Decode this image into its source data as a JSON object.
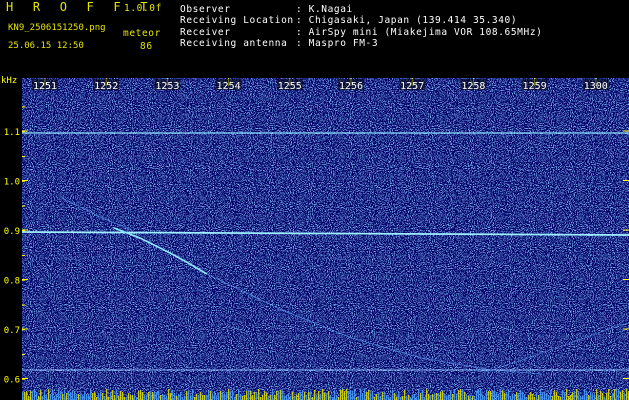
{
  "header": {
    "logo": "H R O F F T",
    "version": "1.0.0f",
    "filename": "KN9_2506151250.png",
    "datetime": "25.06.15 12:50",
    "meteor_label": "meteor",
    "meteor_count": "86",
    "fields": [
      {
        "label": "Observer",
        "value": ": K.Nagai"
      },
      {
        "label": "Receiving Location",
        "value": ": Chigasaki, Japan (139.414 35.340)"
      },
      {
        "label": "Receiver",
        "value": ": AirSpy mini (Miakejima VOR 108.65MHz)"
      },
      {
        "label": "Receiving antenna",
        "value": ": Maspro FM-3"
      }
    ]
  },
  "spectrogram": {
    "y_unit": "kHz",
    "y_ticks": [
      "1.1",
      "1.0",
      "0.9",
      "0.8",
      "0.7",
      "0.6"
    ],
    "x_ticks": [
      "1251",
      "1252",
      "1253",
      "1254",
      "1255",
      "1256",
      "1257",
      "1258",
      "1259",
      "1300"
    ],
    "background_color": "#000066",
    "signal_color": "#6fd4ff",
    "label_color": "#ffff00"
  }
}
